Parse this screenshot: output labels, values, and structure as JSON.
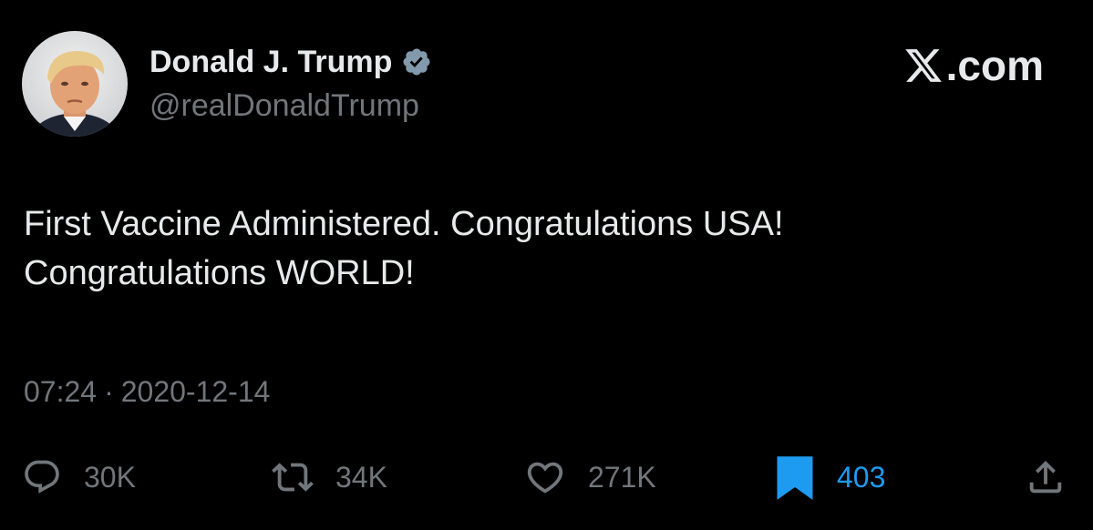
{
  "author": {
    "display_name": "Donald J. Trump",
    "handle": "@realDonaldTrump",
    "verified_icon": "verified-badge-icon",
    "verified_color": "#1d9bf0"
  },
  "brand": {
    "logo_icon": "x-logo-icon",
    "suffix": ".com"
  },
  "tweet": {
    "lines": [
      "First Vaccine Administered. Congratulations USA!",
      "Congratulations WORLD!"
    ]
  },
  "meta": {
    "time": "07:24",
    "separator": "·",
    "date": "2020-12-14"
  },
  "actions": {
    "reply": {
      "icon": "reply-bubble-icon",
      "count": "30K"
    },
    "retweet": {
      "icon": "retweet-icon",
      "count": "34K"
    },
    "like": {
      "icon": "heart-icon",
      "count": "271K"
    },
    "bookmark": {
      "icon": "bookmark-icon",
      "count": "403",
      "active": true,
      "color": "#1d9bf0"
    },
    "share": {
      "icon": "share-upload-icon"
    }
  },
  "colors": {
    "background": "#000000",
    "primary_text": "#e7e9ea",
    "secondary_text": "#71767b",
    "accent": "#1d9bf0"
  }
}
